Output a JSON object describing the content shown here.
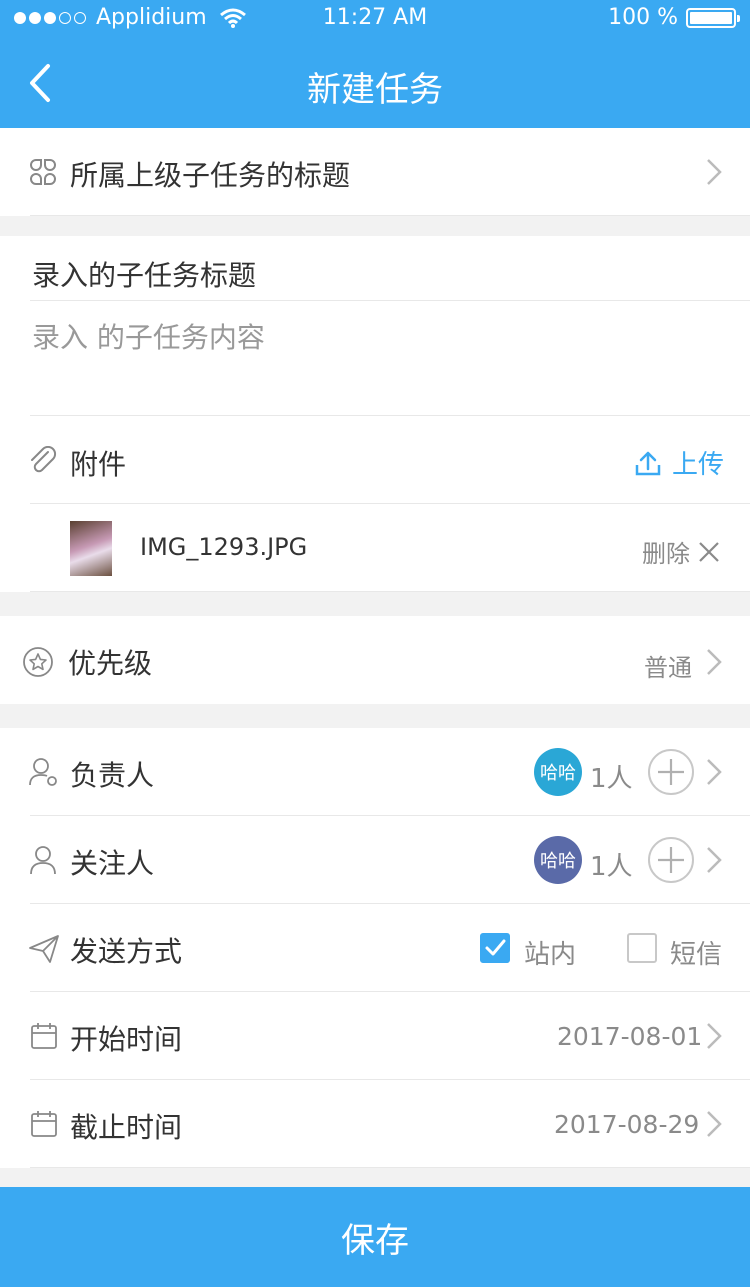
{
  "status_bar": {
    "carrier": "Applidium",
    "time": "11:27 AM",
    "battery": "100 %"
  },
  "nav": {
    "title": "新建任务"
  },
  "parent_task": {
    "label": "所属上级子任务的标题"
  },
  "subtask": {
    "title_value": "录入的子任务标题",
    "content_placeholder": "录入 的子任务内容"
  },
  "attachment": {
    "label": "附件",
    "upload_label": "上传",
    "file_name": "IMG_1293.JPG",
    "delete_label": "删除"
  },
  "priority": {
    "label": "优先级",
    "value": "普通"
  },
  "assignee": {
    "label": "负责人",
    "avatar_text": "哈哈",
    "count": "1人",
    "avatar_color": "#2aa7d6"
  },
  "follower": {
    "label": "关注人",
    "avatar_text": "哈哈",
    "count": "1人",
    "avatar_color": "#5a6aa8"
  },
  "send_method": {
    "label": "发送方式",
    "option_site": "站内",
    "option_site_checked": true,
    "option_sms": "短信",
    "option_sms_checked": false
  },
  "start_time": {
    "label": "开始时间",
    "value": "2017-08-01"
  },
  "end_time": {
    "label": "截止时间",
    "value": "2017-08-29"
  },
  "footer": {
    "save_label": "保存"
  },
  "colors": {
    "accent": "#3aa9f2"
  }
}
